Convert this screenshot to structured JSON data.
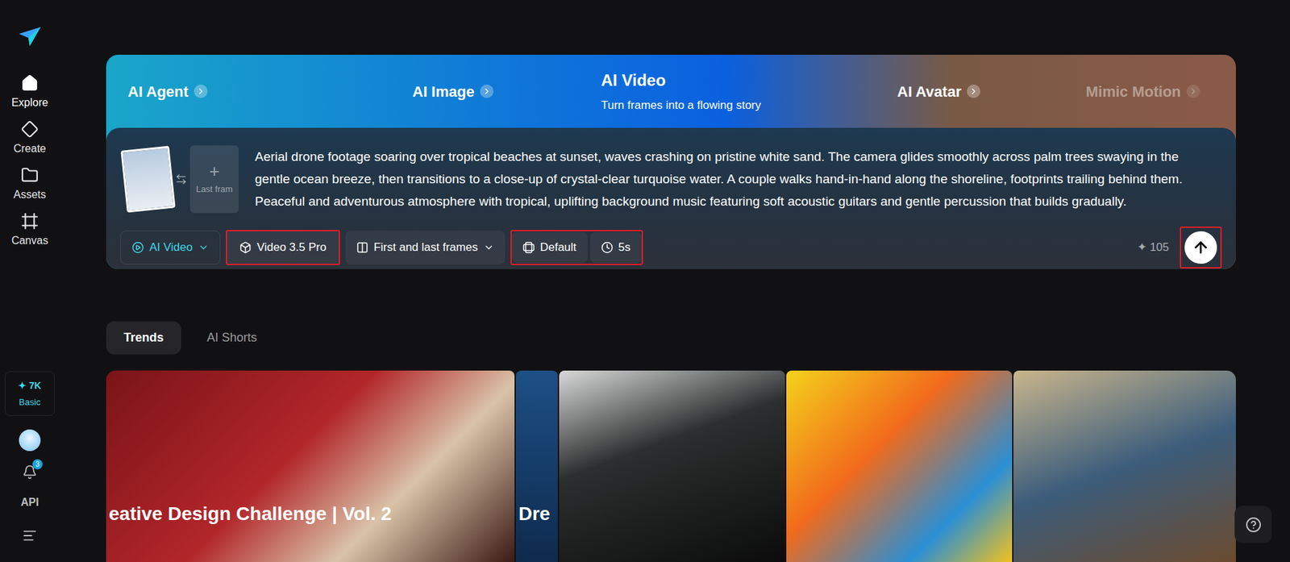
{
  "sidebar": {
    "items": [
      {
        "label": "Explore",
        "selected": true
      },
      {
        "label": "Create",
        "selected": false
      },
      {
        "label": "Assets",
        "selected": false
      },
      {
        "label": "Canvas",
        "selected": false
      }
    ],
    "credits": {
      "icon": "✦",
      "amount": "7K",
      "plan": "Basic"
    },
    "notifications": {
      "count": "3"
    },
    "api": "API"
  },
  "feature_tabs": [
    {
      "label": "AI Agent",
      "selected": false,
      "faded": false,
      "subtitle": ""
    },
    {
      "label": "AI Image",
      "selected": false,
      "faded": false,
      "subtitle": ""
    },
    {
      "label": "AI Video",
      "selected": true,
      "faded": false,
      "subtitle": "Turn frames into a flowing story"
    },
    {
      "label": "AI Avatar",
      "selected": false,
      "faded": false,
      "subtitle": ""
    },
    {
      "label": "Mimic Motion",
      "selected": false,
      "faded": true,
      "subtitle": ""
    }
  ],
  "frames": {
    "add": "+",
    "last_frame_label": "Last fram"
  },
  "prompt": "Aerial drone footage soaring over tropical beaches at sunset, waves crashing on pristine white sand. The camera glides smoothly across palm trees swaying in the gentle ocean breeze, then transitions to a close-up of crystal-clear turquoise water. A couple walks hand-in-hand along the shoreline, footprints trailing behind them. Peaceful and adventurous atmosphere with tropical, uplifting background music featuring soft acoustic guitars and gentle percussion that builds gradually.",
  "toolbar": {
    "mode": {
      "label": "AI Video"
    },
    "model": {
      "label": "Video 3.5 Pro",
      "highlighted": true
    },
    "frames": {
      "label": "First and last frames",
      "highlighted": false
    },
    "settings": {
      "highlighted": true,
      "items": [
        {
          "label": "Default",
          "kind": "ratio"
        },
        {
          "label": "5s",
          "kind": "duration"
        }
      ]
    },
    "cost": {
      "icon": "✦",
      "amount": "105"
    },
    "submit": {
      "highlighted": true
    }
  },
  "content_tabs": [
    {
      "label": "Trends",
      "selected": true
    },
    {
      "label": "AI Shorts",
      "selected": false
    }
  ],
  "gallery": [
    {
      "title": "eative Design Challenge | Vol. 2"
    },
    {
      "title": "Dre"
    },
    {
      "title": ""
    },
    {
      "title": ""
    },
    {
      "title": ""
    }
  ]
}
